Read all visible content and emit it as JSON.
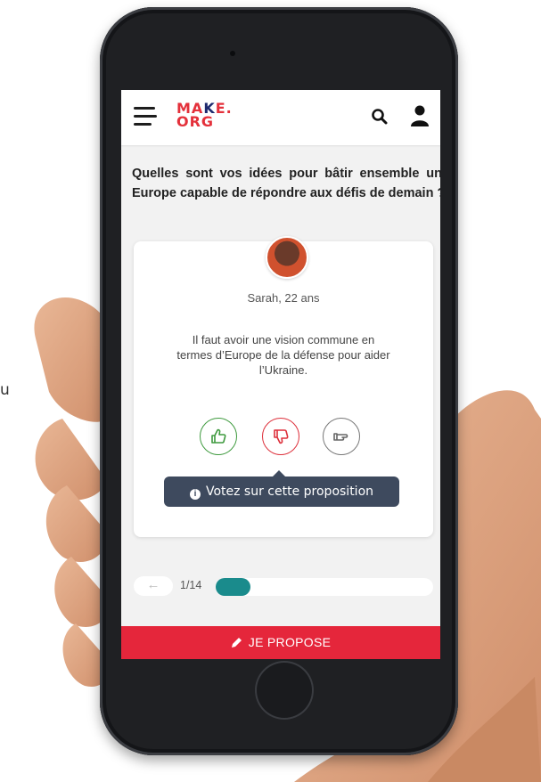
{
  "side_text": "u",
  "header": {
    "logo_line1_a": "MA",
    "logo_line1_b": "K",
    "logo_line1_c": "E.",
    "logo_line2": "ORG"
  },
  "question": "Quelles sont vos idées pour bâtir ensemble une Europe capable de répondre aux défis de demain ?",
  "card": {
    "author": "Sarah, 22 ans",
    "proposal": "Il faut avoir une vision commune en termes d’Europe de la défense pour aider l’Ukraine."
  },
  "votes": [
    {
      "name": "agree",
      "color": "#3e9a3e"
    },
    {
      "name": "disagree",
      "color": "#dd2f3a"
    },
    {
      "name": "neutral",
      "color": "#777777"
    }
  ],
  "tooltip": "Votez sur cette proposition",
  "progress": {
    "back_label": "←",
    "counter": "1/14",
    "current": 1,
    "total": 14,
    "accent": "#1a8b8c"
  },
  "propose_button": {
    "label": "JE PROPOSE",
    "color": "#e5263b"
  },
  "icons": [
    "menu-icon",
    "search-icon",
    "user-icon",
    "thumb-up-icon",
    "thumb-down-icon",
    "neutral-hand-icon",
    "info-icon",
    "arrow-left-icon",
    "pencil-icon"
  ]
}
